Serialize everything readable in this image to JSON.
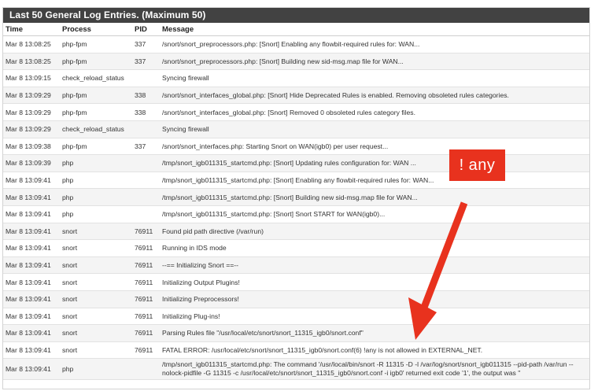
{
  "panel": {
    "title": "Last 50 General Log Entries. (Maximum 50)"
  },
  "columns": {
    "time": "Time",
    "process": "Process",
    "pid": "PID",
    "message": "Message"
  },
  "rows": [
    {
      "time": "Mar 8 13:08:25",
      "process": "php-fpm",
      "pid": "337",
      "message": "/snort/snort_preprocessors.php: [Snort] Enabling any flowbit-required rules for: WAN..."
    },
    {
      "time": "Mar 8 13:08:25",
      "process": "php-fpm",
      "pid": "337",
      "message": "/snort/snort_preprocessors.php: [Snort] Building new sid-msg.map file for WAN..."
    },
    {
      "time": "Mar 8 13:09:15",
      "process": "check_reload_status",
      "pid": "",
      "message": "Syncing firewall"
    },
    {
      "time": "Mar 8 13:09:29",
      "process": "php-fpm",
      "pid": "338",
      "message": "/snort/snort_interfaces_global.php: [Snort] Hide Deprecated Rules is enabled. Removing obsoleted rules categories."
    },
    {
      "time": "Mar 8 13:09:29",
      "process": "php-fpm",
      "pid": "338",
      "message": "/snort/snort_interfaces_global.php: [Snort] Removed 0 obsoleted rules category files."
    },
    {
      "time": "Mar 8 13:09:29",
      "process": "check_reload_status",
      "pid": "",
      "message": "Syncing firewall"
    },
    {
      "time": "Mar 8 13:09:38",
      "process": "php-fpm",
      "pid": "337",
      "message": "/snort/snort_interfaces.php: Starting Snort on WAN(igb0) per user request..."
    },
    {
      "time": "Mar 8 13:09:39",
      "process": "php",
      "pid": "",
      "message": "/tmp/snort_igb011315_startcmd.php: [Snort] Updating rules configuration for: WAN ..."
    },
    {
      "time": "Mar 8 13:09:41",
      "process": "php",
      "pid": "",
      "message": "/tmp/snort_igb011315_startcmd.php: [Snort] Enabling any flowbit-required rules for: WAN..."
    },
    {
      "time": "Mar 8 13:09:41",
      "process": "php",
      "pid": "",
      "message": "/tmp/snort_igb011315_startcmd.php: [Snort] Building new sid-msg.map file for WAN..."
    },
    {
      "time": "Mar 8 13:09:41",
      "process": "php",
      "pid": "",
      "message": "/tmp/snort_igb011315_startcmd.php: [Snort] Snort START for WAN(igb0)..."
    },
    {
      "time": "Mar 8 13:09:41",
      "process": "snort",
      "pid": "76911",
      "message": "Found pid path directive (/var/run)"
    },
    {
      "time": "Mar 8 13:09:41",
      "process": "snort",
      "pid": "76911",
      "message": "Running in IDS mode"
    },
    {
      "time": "Mar 8 13:09:41",
      "process": "snort",
      "pid": "76911",
      "message": "--== Initializing Snort ==--"
    },
    {
      "time": "Mar 8 13:09:41",
      "process": "snort",
      "pid": "76911",
      "message": "Initializing Output Plugins!"
    },
    {
      "time": "Mar 8 13:09:41",
      "process": "snort",
      "pid": "76911",
      "message": "Initializing Preprocessors!"
    },
    {
      "time": "Mar 8 13:09:41",
      "process": "snort",
      "pid": "76911",
      "message": "Initializing Plug-ins!"
    },
    {
      "time": "Mar 8 13:09:41",
      "process": "snort",
      "pid": "76911",
      "message": "Parsing Rules file \"/usr/local/etc/snort/snort_11315_igb0/snort.conf\""
    },
    {
      "time": "Mar 8 13:09:41",
      "process": "snort",
      "pid": "76911",
      "message": "FATAL ERROR: /usr/local/etc/snort/snort_11315_igb0/snort.conf(6) !any is not allowed in EXTERNAL_NET."
    },
    {
      "time": "Mar 8 13:09:41",
      "process": "php",
      "pid": "",
      "message": "/tmp/snort_igb011315_startcmd.php: The command '/usr/local/bin/snort -R 11315 -D -l /var/log/snort/snort_igb011315 --pid-path /var/run --nolock-pidfile -G 11315 -c /usr/local/etc/snort/snort_11315_igb0/snort.conf -i igb0' returned exit code '1', the output was ''"
    }
  ],
  "annotation": {
    "label": "! any",
    "color": "#e8321e"
  }
}
